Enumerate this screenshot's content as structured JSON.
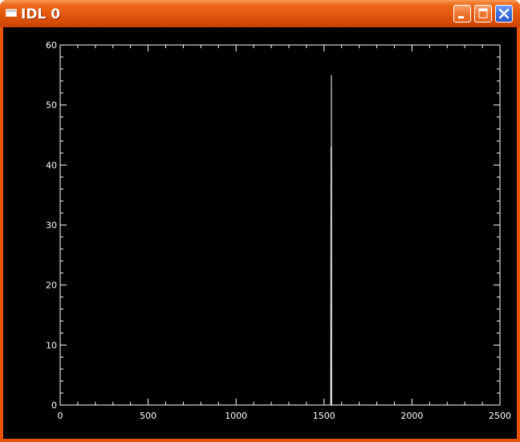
{
  "window": {
    "title": "IDL 0"
  },
  "icons": {
    "app": "window-icon",
    "minimize": "minimize-icon",
    "maximize": "maximize-icon",
    "close": "close-icon"
  },
  "colors": {
    "titlebar": "#e2560c",
    "plot_background": "#000000",
    "plot_foreground": "#ffffff",
    "close_button": "#3f73e2"
  },
  "chart_data": {
    "type": "line",
    "xlim": [
      0,
      2500
    ],
    "ylim": [
      0,
      60
    ],
    "xticks": [
      0,
      500,
      1000,
      1500,
      2000,
      2500
    ],
    "yticks": [
      0,
      10,
      20,
      30,
      40,
      50,
      60
    ],
    "xlabel": "",
    "ylabel": "",
    "title": "",
    "grid": false,
    "series": [
      {
        "x": [
          0,
          1538,
          1540,
          1541,
          1542,
          1543,
          1544,
          1550,
          2500
        ],
        "y": [
          0,
          0,
          43,
          0,
          55,
          0,
          0,
          0,
          0
        ]
      }
    ]
  }
}
